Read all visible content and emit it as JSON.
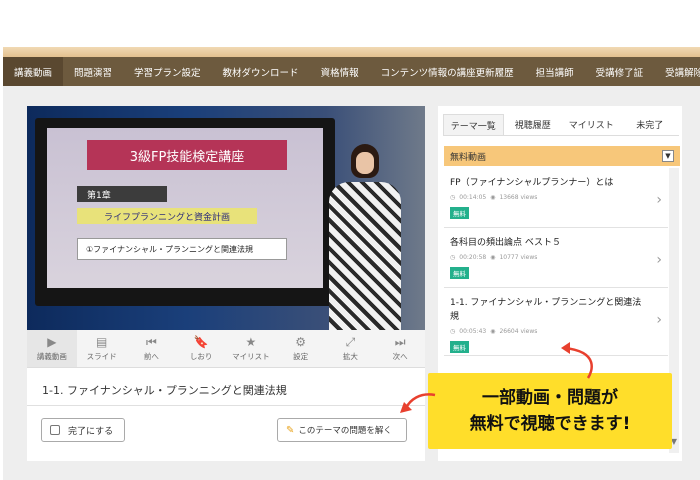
{
  "nav": {
    "items": [
      "講義動画",
      "問題演習",
      "学習プラン設定",
      "教材ダウンロード",
      "資格情報",
      "コンテンツ情報の講座更新履歴",
      "担当講師",
      "受講修了証",
      "受講解除"
    ]
  },
  "video": {
    "slide_title": "3級FP技能検定講座",
    "chapter": "第1章",
    "subtitle": "ライフプランニングと資金計画",
    "bullet": "①ファイナンシャル・プランニングと関連法規"
  },
  "controls": [
    {
      "label": "講義動画",
      "icon": "play-circle-icon"
    },
    {
      "label": "スライド",
      "icon": "slide-icon"
    },
    {
      "label": "前へ",
      "icon": "previous-icon"
    },
    {
      "label": "しおり",
      "icon": "bookmark-icon"
    },
    {
      "label": "マイリスト",
      "icon": "star-plus-icon"
    },
    {
      "label": "設定",
      "icon": "gear-icon"
    },
    {
      "label": "拡大",
      "icon": "expand-icon"
    },
    {
      "label": "次へ",
      "icon": "next-icon"
    }
  ],
  "lesson": {
    "title": "1-1. ファイナンシャル・プランニングと関連法規",
    "done_label": "完了にする",
    "solve_label": "このテーマの問題を解く"
  },
  "sidebar": {
    "tabs": [
      "テーマ一覧",
      "視聴履歴",
      "マイリスト",
      "未完了"
    ],
    "select_value": "無料動画",
    "items": [
      {
        "title": "FP（ファイナンシャルプランナー）とは",
        "duration": "00:14:05",
        "views": "13668 views",
        "badge": "無料"
      },
      {
        "title": "各科目の頻出論点 ベスト５",
        "duration": "00:20:58",
        "views": "10777 views",
        "badge": "無料"
      },
      {
        "title": "1-1. ファイナンシャル・プランニングと関連法規",
        "duration": "00:05:43",
        "views": "26604 views",
        "badge": "無料"
      }
    ]
  },
  "callout": {
    "line1": "一部動画・問題が",
    "line2": "無料で視聴できます!"
  },
  "colors": {
    "nav_bg": "#6d5a3e",
    "select_bg": "#f7c77a",
    "badge": "#23b08c",
    "callout_bg": "#ffde2a",
    "arrow": "#e8402e"
  }
}
